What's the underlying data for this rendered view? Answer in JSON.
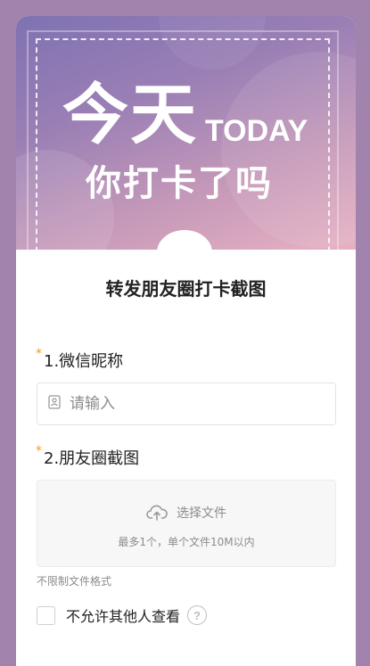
{
  "banner": {
    "headline_main": "今天",
    "headline_en": "TODAY",
    "headline_sub": "你打卡了吗"
  },
  "form": {
    "title": "转发朋友圈打卡截图",
    "required_mark": "*",
    "question1": {
      "label": "1.微信昵称",
      "placeholder": "请输入",
      "icon": "user-card-icon"
    },
    "question2": {
      "label": "2.朋友圈截图",
      "upload_label": "选择文件",
      "upload_hint": "最多1个，单个文件10M以内",
      "format_note": "不限制文件格式",
      "icon": "cloud-upload-icon"
    },
    "privacy": {
      "label": "不允许其他人查看",
      "help": "?"
    }
  },
  "colors": {
    "page_bg": "#a283ad",
    "required": "#f59a23",
    "banner_start": "#7f72b2",
    "banner_end": "#e7b1c3"
  }
}
